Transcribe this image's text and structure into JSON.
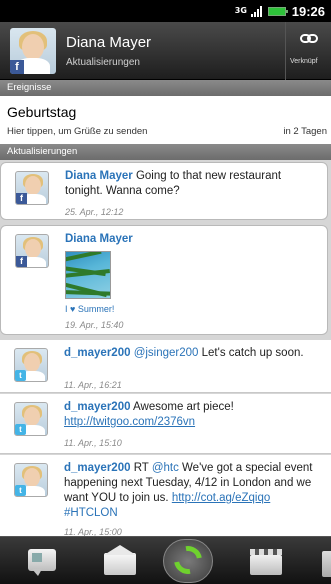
{
  "status_bar": {
    "network": "3G",
    "time": "19:26"
  },
  "contact": {
    "name": "Diana Mayer",
    "subtitle": "Aktualisierungen",
    "link_label": "Verknüpf",
    "badge": "f"
  },
  "sections": {
    "events": "Ereignisse",
    "updates": "Aktualisierungen"
  },
  "event": {
    "title": "Geburtstag",
    "hint": "Hier tippen, um Grüße zu senden",
    "when": "in 2 Tagen"
  },
  "updates": [
    {
      "source": "facebook",
      "author": "Diana Mayer",
      "text": " Going to that new restaurant tonight. Wanna come?",
      "time": "25. Apr., 12:12"
    },
    {
      "source": "facebook",
      "author": "Diana Mayer",
      "caption": "I ♥ Summer!",
      "time": "19. Apr., 15:40"
    },
    {
      "source": "twitter",
      "author": "d_mayer200",
      "mention": " @jsinger200",
      "text": " Let's catch up soon.",
      "time": "11. Apr., 16:21"
    },
    {
      "source": "twitter",
      "author": "d_mayer200",
      "text": " Awesome art piece!",
      "link": "http://twitgoo.com/2376vn",
      "time": "11. Apr., 15:10"
    },
    {
      "source": "twitter",
      "author": "d_mayer200",
      "text_a": " RT ",
      "mention": "@htc",
      "text_b": " We've got a special event happening next Tuesday, 4/12 in London and we want YOU to join us. ",
      "link": "http://cot.ag/eZqiqo",
      "hashtag": " #HTCLON",
      "time": "11. Apr., 15:00"
    }
  ],
  "toolbar": {
    "icons": [
      "message-icon",
      "mail-icon",
      "refresh-icon",
      "media-icon",
      "more-icon"
    ],
    "accent": "#6fd12e"
  },
  "colors": {
    "link": "#2a73b8",
    "facebook": "#3b5998",
    "twitter": "#44b4e6",
    "battery": "#2ec33a"
  }
}
